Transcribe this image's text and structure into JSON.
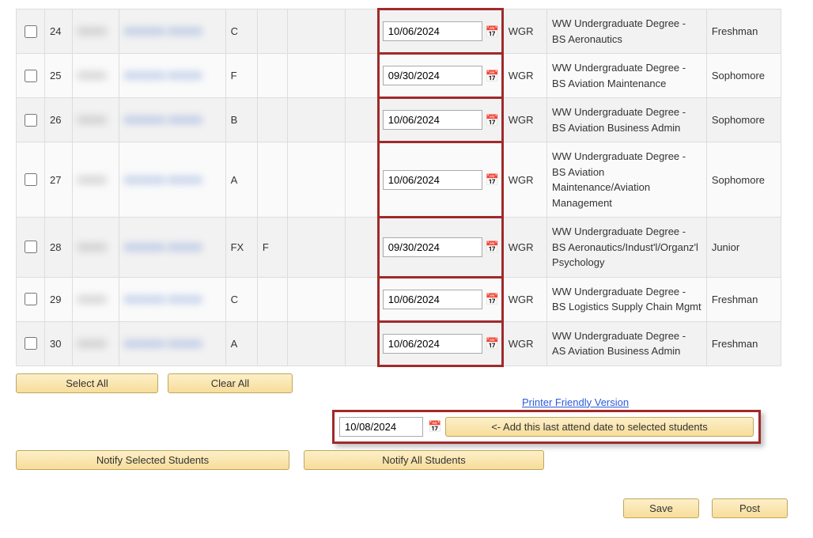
{
  "rows": [
    {
      "num": "24",
      "grade": "C",
      "blank2": "",
      "date": "10/06/2024",
      "code": "WGR",
      "degree": "WW Undergraduate Degree - BS Aeronautics",
      "standing": "Freshman"
    },
    {
      "num": "25",
      "grade": "F",
      "blank2": "",
      "date": "09/30/2024",
      "code": "WGR",
      "degree": "WW Undergraduate Degree - BS Aviation Maintenance",
      "standing": "Sophomore"
    },
    {
      "num": "26",
      "grade": "B",
      "blank2": "",
      "date": "10/06/2024",
      "code": "WGR",
      "degree": "WW Undergraduate Degree - BS Aviation Business Admin",
      "standing": "Sophomore"
    },
    {
      "num": "27",
      "grade": "A",
      "blank2": "",
      "date": "10/06/2024",
      "code": "WGR",
      "degree": "WW Undergraduate Degree - BS Aviation Maintenance/Aviation Management",
      "standing": "Sophomore"
    },
    {
      "num": "28",
      "grade": "FX",
      "blank2": "F",
      "date": "09/30/2024",
      "code": "WGR",
      "degree": "WW Undergraduate Degree - BS Aeronautics/Indust'l/Organz'l Psychology",
      "standing": "Junior"
    },
    {
      "num": "29",
      "grade": "C",
      "blank2": "",
      "date": "10/06/2024",
      "code": "WGR",
      "degree": "WW Undergraduate Degree - BS Logistics Supply Chain Mgmt",
      "standing": "Freshman"
    },
    {
      "num": "30",
      "grade": "A",
      "blank2": "",
      "date": "10/06/2024",
      "code": "WGR",
      "degree": "WW Undergraduate Degree - AS Aviation Business Admin",
      "standing": "Freshman"
    }
  ],
  "buttons": {
    "select_all": "Select All",
    "clear_all": "Clear All",
    "printer_friendly": "Printer Friendly Version",
    "add_date": "<- Add this last attend date to selected students",
    "notify_selected": "Notify Selected Students",
    "notify_all": "Notify All Students",
    "save": "Save",
    "post": "Post"
  },
  "add_date_value": "10/08/2024"
}
